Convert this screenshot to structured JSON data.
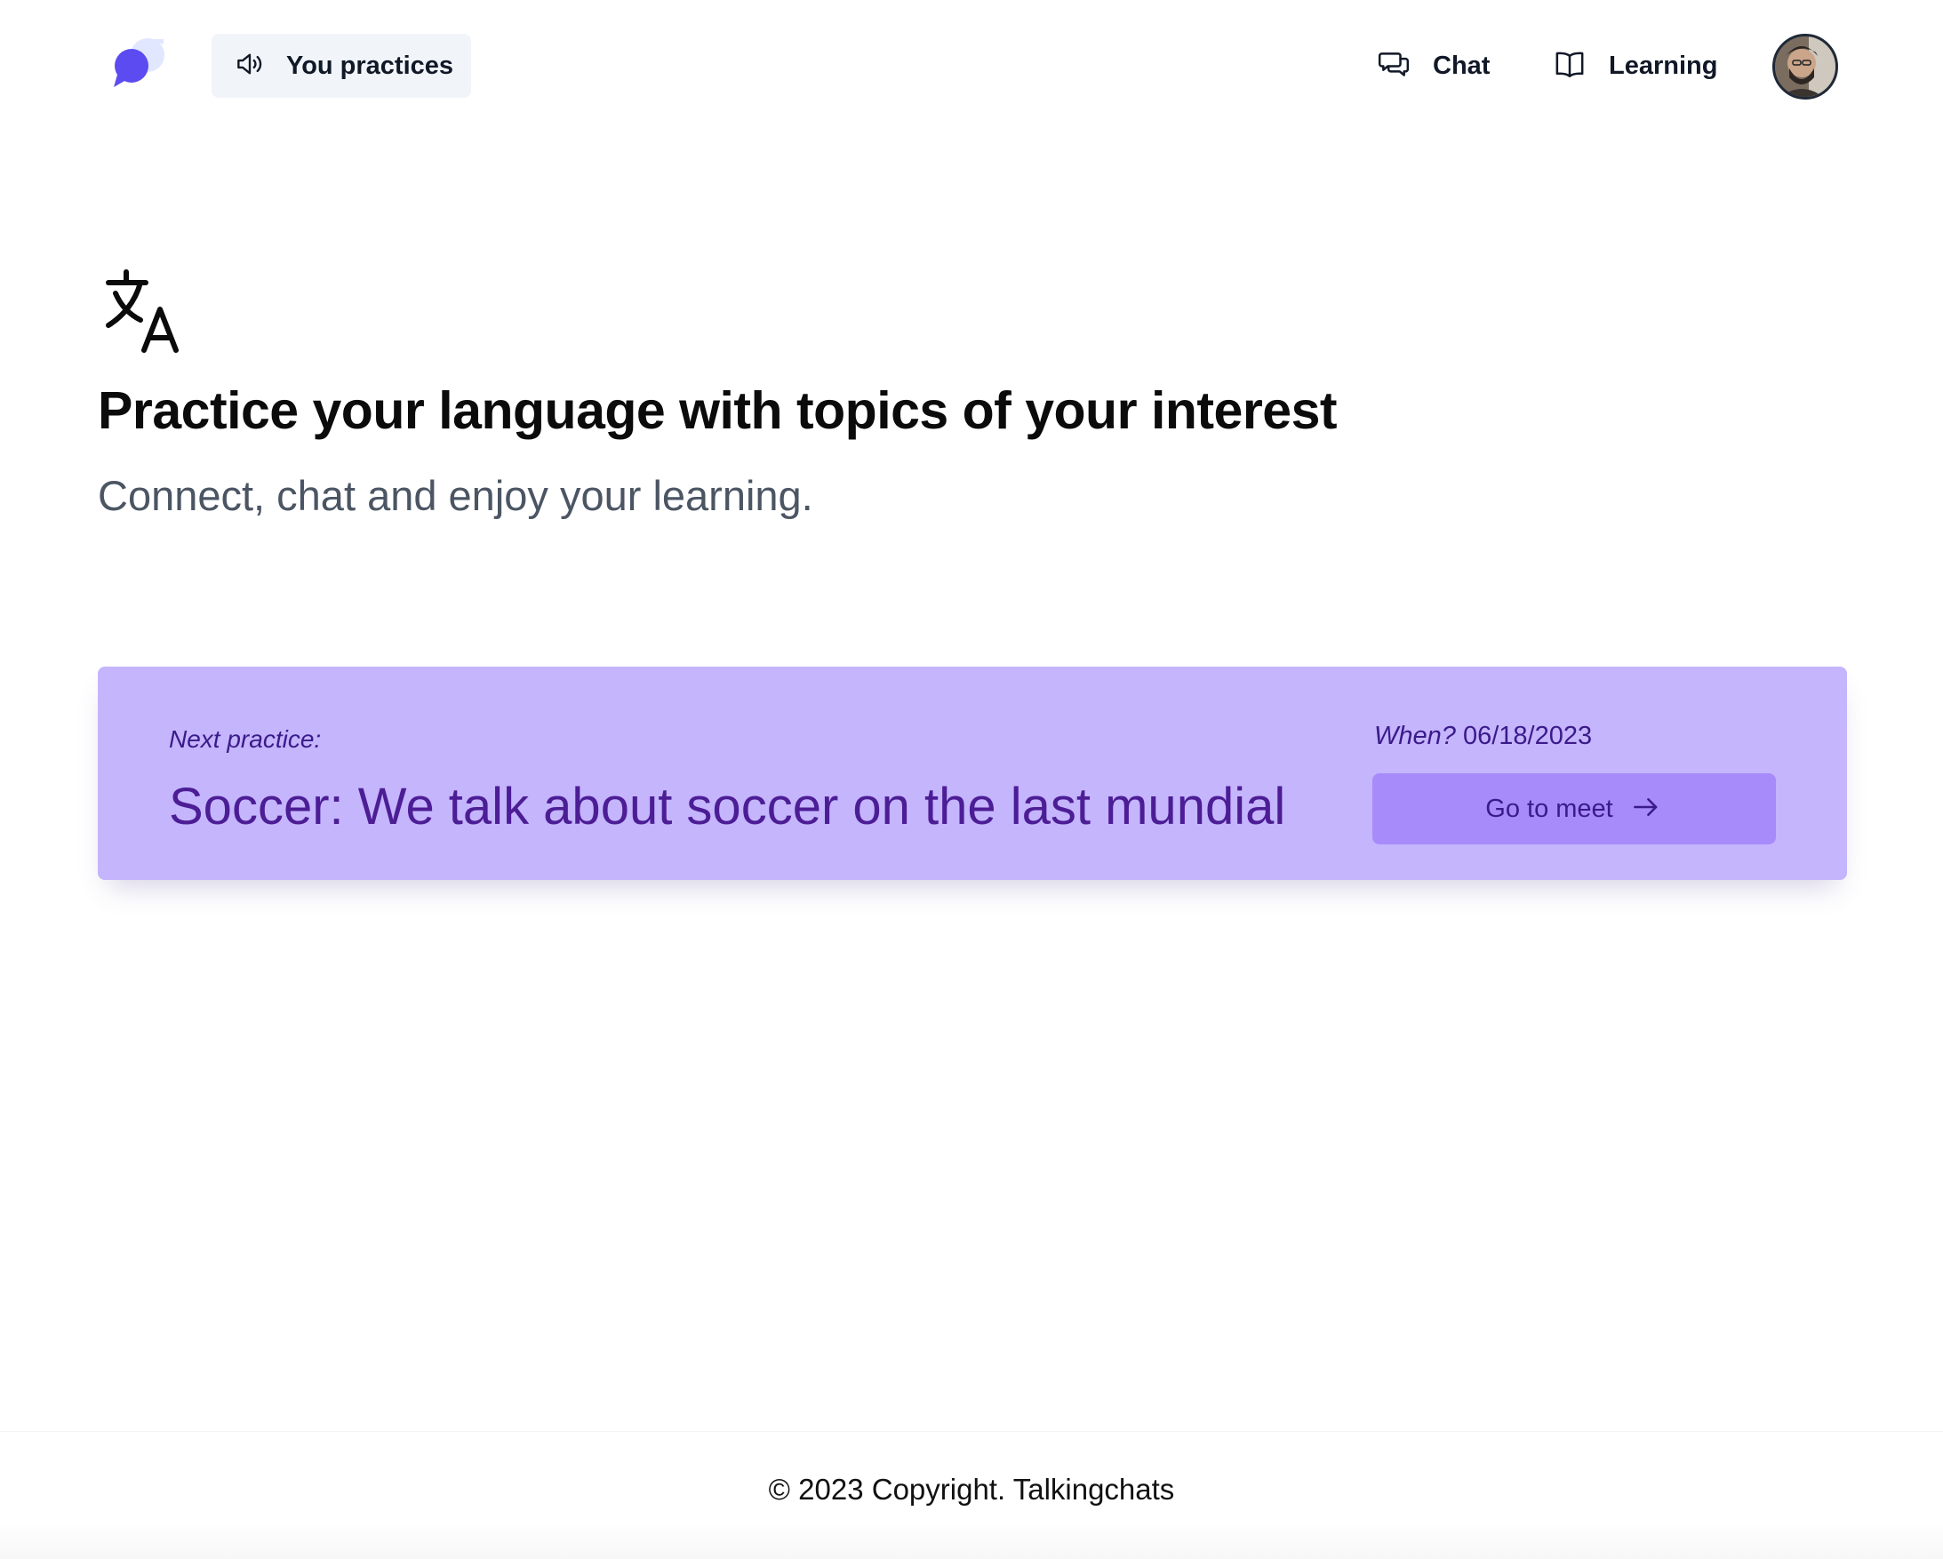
{
  "header": {
    "practices_label": "You practices",
    "nav": {
      "chat_label": "Chat",
      "learning_label": "Learning"
    }
  },
  "hero": {
    "title": "Practice your language with topics of your interest",
    "subtitle": "Connect, chat and enjoy your learning."
  },
  "next_practice": {
    "kicker": "Next practice:",
    "topic": "Soccer: We talk about soccer on the last mundial",
    "when_label": "When?",
    "when_date": "06/18/2023",
    "button_label": "Go to meet"
  },
  "footer": {
    "copyright": "© 2023 Copyright. Talkingchats"
  },
  "icons": {
    "logo": "chat-bubbles-logo-icon",
    "practices": "speaker-icon",
    "chat": "chat-bubbles-icon",
    "learning": "book-open-icon",
    "hero": "translate-icon",
    "go": "arrow-right-icon"
  },
  "colors": {
    "accent": "#6d5bf6",
    "card_bg": "#c4b5fd",
    "button_bg": "#a78bfa",
    "card_text": "#4c1d95",
    "practices_bg": "#f1f5f9"
  }
}
